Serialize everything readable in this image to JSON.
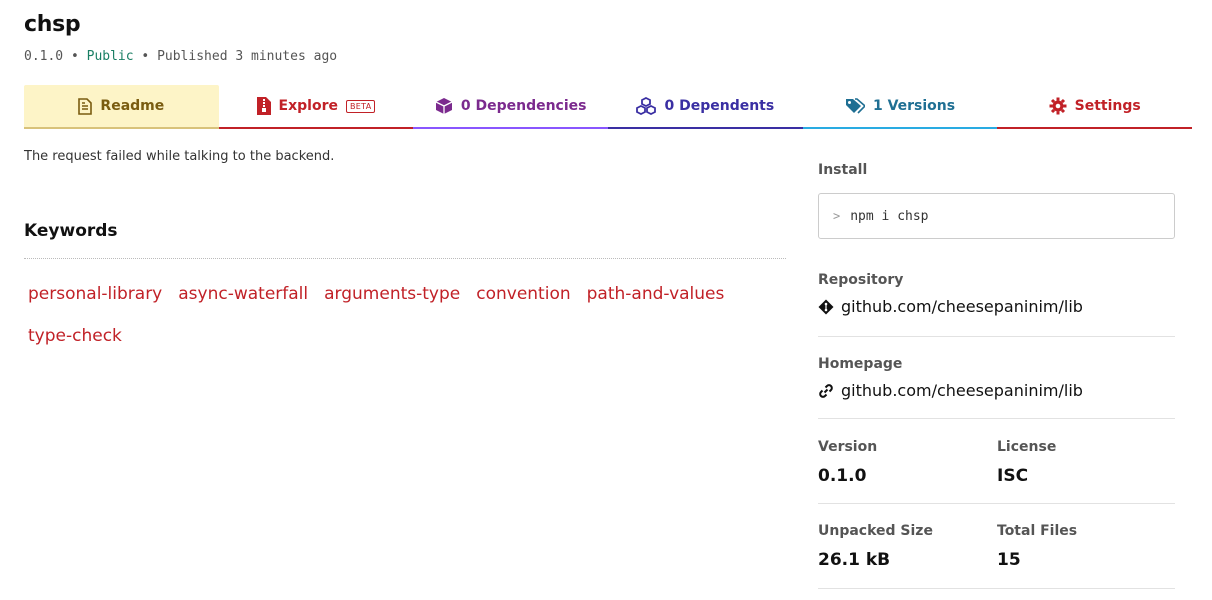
{
  "package": {
    "name": "chsp",
    "version": "0.1.0",
    "sep1": "•",
    "visibility": "Public",
    "sep2": "•",
    "published": "Published 3 minutes ago"
  },
  "tabs": {
    "readme": "Readme",
    "explore": "Explore",
    "explore_badge": "BETA",
    "dependencies": "0 Dependencies",
    "dependents": "0 Dependents",
    "versions": "1 Versions",
    "settings": "Settings"
  },
  "readme": {
    "error": "The request failed while talking to the backend."
  },
  "keywords": {
    "heading": "Keywords",
    "items": [
      "personal-library",
      "async-waterfall",
      "arguments-type",
      "convention",
      "path-and-values",
      "type-check"
    ]
  },
  "sidebar": {
    "install_label": "Install",
    "install_prompt": ">",
    "install_command": "npm i chsp",
    "repository_label": "Repository",
    "repository_link": "github.com/cheesepaninim/lib",
    "homepage_label": "Homepage",
    "homepage_link": "github.com/cheesepaninim/lib",
    "version_label": "Version",
    "version_value": "0.1.0",
    "license_label": "License",
    "license_value": "ISC",
    "unpacked_label": "Unpacked Size",
    "unpacked_value": "26.1 kB",
    "files_label": "Total Files",
    "files_value": "15"
  },
  "colors": {
    "accent_red": "#c12127",
    "public_green": "#1a7f64",
    "readme_bg": "#fdf4c7"
  }
}
